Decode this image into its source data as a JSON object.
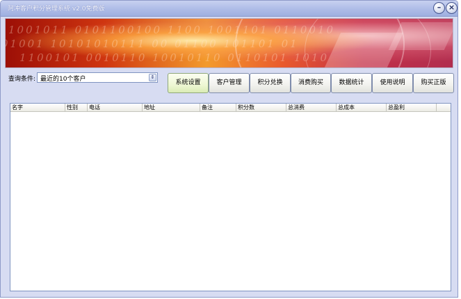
{
  "window": {
    "title": "阿冲客户积分管理系统 v2.0免费版",
    "minimize_glyph": "–",
    "close_glyph": "×"
  },
  "banner": {
    "binary_line_1": "1001011 0101100100 1100 1001101 0110010",
    "binary_line_2": "01001 10101010111 00 01100 101101 01",
    "binary_line_3": "1100101 0010110 10010110 0110101 1010"
  },
  "filter": {
    "label": "查询条件:",
    "selected_option": "最近的10个客户",
    "dropdown_icon": "spinner-arrows-icon",
    "dropdown_glyph": "⇕"
  },
  "toolbar": {
    "buttons": [
      {
        "label": "系统设置",
        "active": true
      },
      {
        "label": "客户管理",
        "active": false
      },
      {
        "label": "积分兑换",
        "active": false
      },
      {
        "label": "消费购买",
        "active": false
      },
      {
        "label": "数据统计",
        "active": false
      },
      {
        "label": "使用说明",
        "active": false
      },
      {
        "label": "购买正版",
        "active": false
      }
    ]
  },
  "table": {
    "columns": [
      "名字",
      "性别",
      "电话",
      "地址",
      "备注",
      "积分数",
      "总消费",
      "总成本",
      "总盈利"
    ],
    "rows": []
  },
  "colors": {
    "window_bg": "#d7dcf2",
    "titlebar": "#aebce7",
    "active_button": "#eef7d4"
  }
}
